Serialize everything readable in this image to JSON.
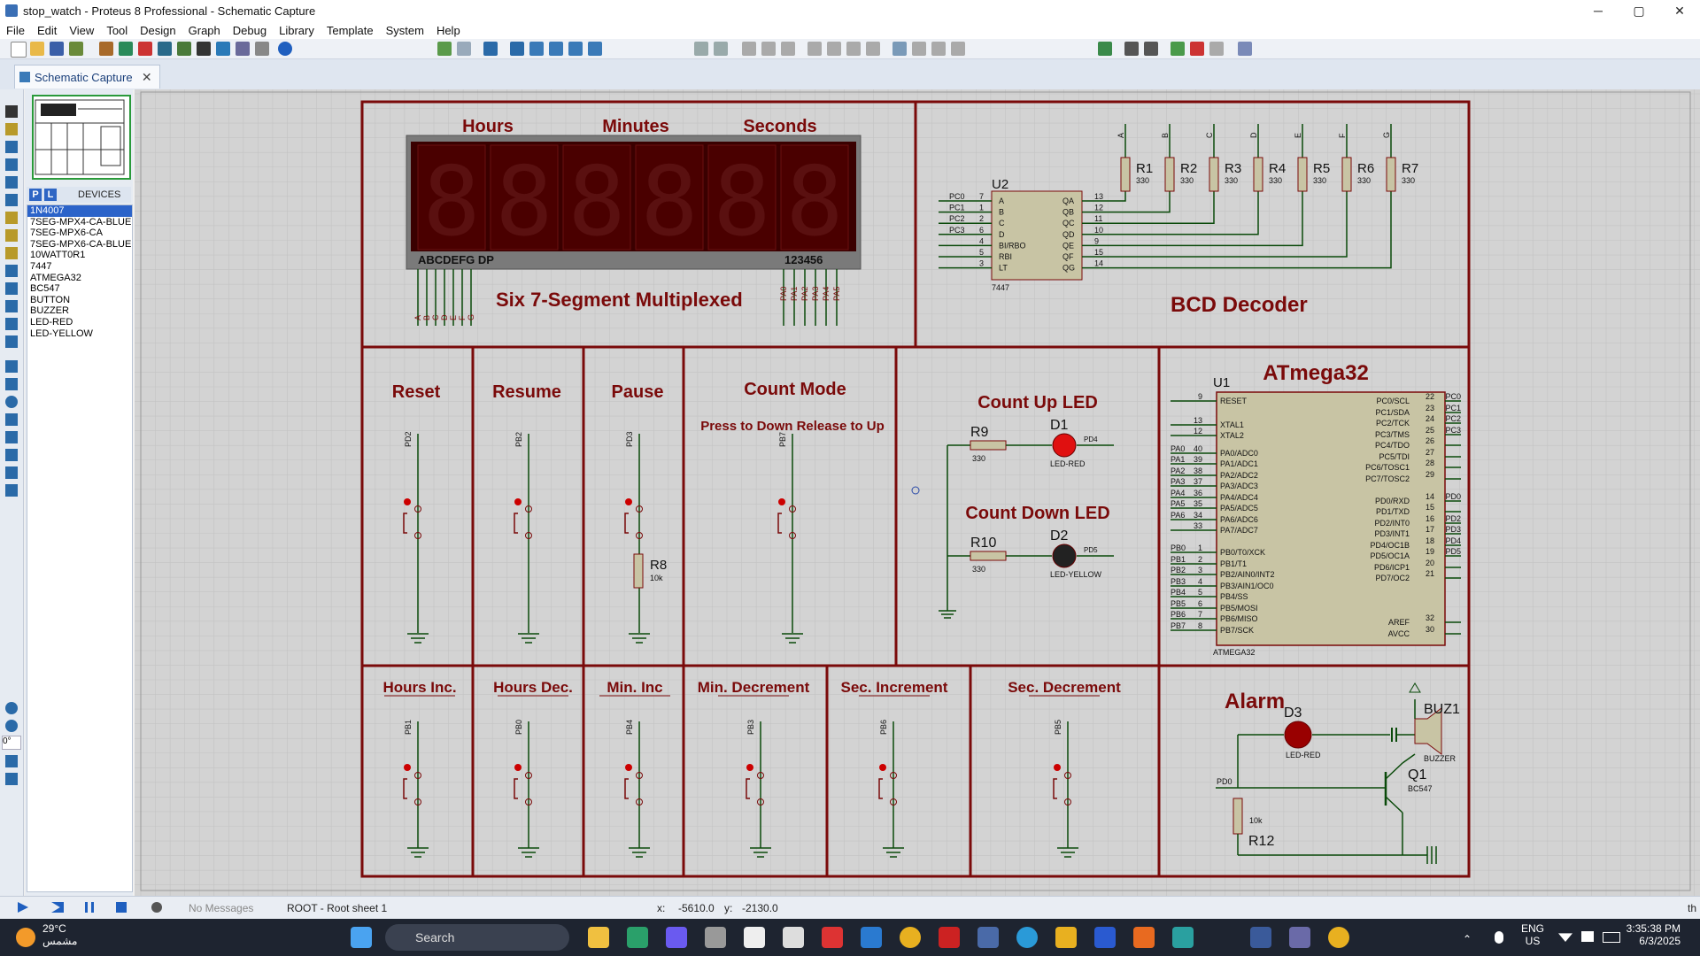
{
  "window": {
    "title": "stop_watch - Proteus 8 Professional - Schematic Capture",
    "min_label": "─",
    "max_label": "▢",
    "close_label": "✕"
  },
  "menu": [
    "File",
    "Edit",
    "View",
    "Tool",
    "Design",
    "Graph",
    "Debug",
    "Library",
    "Template",
    "System",
    "Help"
  ],
  "tab": {
    "label": "Schematic Capture",
    "close": "✕"
  },
  "panel": {
    "p_label": "P",
    "l_label": "L",
    "devices_label": "DEVICES",
    "devices": [
      "1N4007",
      "7SEG-MPX4-CA-BLUE",
      "7SEG-MPX6-CA",
      "7SEG-MPX6-CA-BLUE",
      "10WATT0R1",
      "7447",
      "ATMEGA32",
      "BC547",
      "BUTTON",
      "BUZZER",
      "LED-RED",
      "LED-YELLOW"
    ],
    "selected_index": 0
  },
  "rotation": "0°",
  "status": {
    "messages": "No Messages",
    "sheet": "ROOT - Root sheet 1",
    "x_label": "x:",
    "x_value": "-5610.0",
    "y_label": "y:",
    "y_value": "-2130.0",
    "right": "th"
  },
  "schematic": {
    "display_headers": [
      "Hours",
      "Minutes",
      "Seconds"
    ],
    "display_bottom_left": "ABCDEFG DP",
    "display_bottom_right": "123456",
    "seg_pins": [
      "A",
      "B",
      "C",
      "D",
      "E",
      "F",
      "G"
    ],
    "digit_pins": [
      "PA0",
      "PA1",
      "PA2",
      "PA3",
      "PA4",
      "PA5"
    ],
    "display_title": "Six 7-Segment Multiplexed",
    "bcd_title": "BCD Decoder",
    "decoder": {
      "ref": "U2",
      "part": "7447",
      "in_pins": [
        [
          "PC0",
          "7",
          "A"
        ],
        [
          "PC1",
          "1",
          "B"
        ],
        [
          "PC2",
          "2",
          "C"
        ],
        [
          "PC3",
          "6",
          "D"
        ],
        [
          "",
          "4",
          "BI/RBO"
        ],
        [
          "",
          "5",
          "RBI"
        ],
        [
          "",
          "3",
          "LT"
        ]
      ],
      "out_pins": [
        [
          "QA",
          "13"
        ],
        [
          "QB",
          "12"
        ],
        [
          "QC",
          "11"
        ],
        [
          "QD",
          "10"
        ],
        [
          "QE",
          "9"
        ],
        [
          "QF",
          "15"
        ],
        [
          "QG",
          "14"
        ]
      ]
    },
    "resistors_top": [
      [
        "R1",
        "330",
        "A"
      ],
      [
        "R2",
        "330",
        "B"
      ],
      [
        "R3",
        "330",
        "C"
      ],
      [
        "R4",
        "330",
        "D"
      ],
      [
        "R5",
        "330",
        "E"
      ],
      [
        "R6",
        "330",
        "F"
      ],
      [
        "R7",
        "330",
        "G"
      ]
    ],
    "buttons_mid": [
      [
        "Reset",
        "PD2"
      ],
      [
        "Resume",
        "PB2"
      ],
      [
        "Pause",
        "PD3"
      ]
    ],
    "count_mode_title": "Count Mode",
    "count_mode_sub": "Press to Down Release to Up",
    "count_mode_pin": "PB7",
    "r8": [
      "R8",
      "10k"
    ],
    "count_up": {
      "title": "Count Up LED",
      "r": "R9",
      "rv": "330",
      "d": "D1",
      "part": "LED-RED",
      "pin": "PD4"
    },
    "count_down": {
      "title": "Count Down LED",
      "r": "R10",
      "rv": "330",
      "d": "D2",
      "part": "LED-YELLOW",
      "pin": "PD5"
    },
    "mcu": {
      "title": "ATmega32",
      "ref": "U1",
      "part": "ATMEGA32",
      "left": [
        [
          "9",
          "RESET"
        ],
        [
          "13",
          "XTAL1"
        ],
        [
          "12",
          "XTAL2"
        ],
        [
          "40",
          "PA0/ADC0"
        ],
        [
          "39",
          "PA1/ADC1"
        ],
        [
          "38",
          "PA2/ADC2"
        ],
        [
          "37",
          "PA3/ADC3"
        ],
        [
          "36",
          "PA4/ADC4"
        ],
        [
          "35",
          "PA5/ADC5"
        ],
        [
          "34",
          "PA6/ADC6"
        ],
        [
          "33",
          "PA7/ADC7"
        ],
        [
          "1",
          "PB0/T0/XCK"
        ],
        [
          "2",
          "PB1/T1"
        ],
        [
          "3",
          "PB2/AIN0/INT2"
        ],
        [
          "4",
          "PB3/AIN1/OC0"
        ],
        [
          "5",
          "PB4/SS"
        ],
        [
          "6",
          "PB5/MOSI"
        ],
        [
          "7",
          "PB6/MISO"
        ],
        [
          "8",
          "PB7/SCK"
        ]
      ],
      "left_nets": [
        "",
        "",
        "",
        "PA0",
        "PA1",
        "PA2",
        "PA3",
        "PA4",
        "PA5",
        "PA6",
        "",
        "PB0",
        "PB1",
        "PB2",
        "PB3",
        "PB4",
        "PB5",
        "PB6",
        "PB7"
      ],
      "right": [
        [
          "22",
          "PC0/SCL"
        ],
        [
          "23",
          "PC1/SDA"
        ],
        [
          "24",
          "PC2/TCK"
        ],
        [
          "25",
          "PC3/TMS"
        ],
        [
          "26",
          "PC4/TDO"
        ],
        [
          "27",
          "PC5/TDI"
        ],
        [
          "28",
          "PC6/TOSC1"
        ],
        [
          "29",
          "PC7/TOSC2"
        ],
        [
          "14",
          "PD0/RXD"
        ],
        [
          "15",
          "PD1/TXD"
        ],
        [
          "16",
          "PD2/INT0"
        ],
        [
          "17",
          "PD3/INT1"
        ],
        [
          "18",
          "PD4/OC1B"
        ],
        [
          "19",
          "PD5/OC1A"
        ],
        [
          "20",
          "PD6/ICP1"
        ],
        [
          "21",
          "PD7/OC2"
        ],
        [
          "32",
          "AREF"
        ],
        [
          "30",
          "AVCC"
        ]
      ],
      "right_nets": [
        "PC0",
        "PC1",
        "PC2",
        "PC3",
        "",
        "",
        "",
        "",
        "PD0",
        "",
        "PD2",
        "PD3",
        "PD4",
        "PD5",
        "",
        "",
        "",
        ""
      ]
    },
    "buttons_bottom": [
      [
        "Hours Inc.",
        "PB1"
      ],
      [
        "Hours Dec.",
        "PB0"
      ],
      [
        "Min. Inc",
        "PB4"
      ],
      [
        "Min. Decrement",
        "PB3"
      ],
      [
        "Sec. Increment",
        "PB6"
      ],
      [
        "Sec. Decrement",
        "PB5"
      ]
    ],
    "alarm": {
      "title": "Alarm",
      "d": "D3",
      "dpart": "LED-RED",
      "buz": "BUZ1",
      "buzpart": "BUZZER",
      "q": "Q1",
      "qpart": "BC547",
      "r": "R12",
      "rv": "10k",
      "pin": "PD0"
    }
  },
  "taskbar": {
    "temp": "29°C",
    "weather": "مشمس",
    "search": "Search",
    "lang1": "ENG",
    "lang2": "US",
    "time": "3:35:38 PM",
    "date": "6/3/2025"
  }
}
